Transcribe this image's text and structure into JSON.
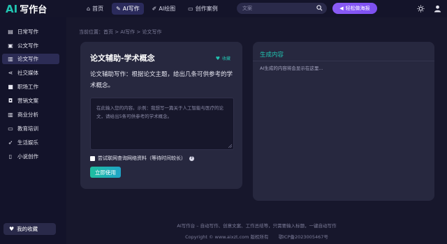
{
  "brand": {
    "logo_ai": "AI",
    "logo_text": "写作台"
  },
  "nav": {
    "items": [
      {
        "label": "首页",
        "icon": "home-icon"
      },
      {
        "label": "AI写作",
        "icon": "edit-icon",
        "active": true
      },
      {
        "label": "AI绘图",
        "icon": "brush-icon"
      },
      {
        "label": "创作案例",
        "icon": "folder-icon"
      }
    ]
  },
  "search": {
    "placeholder": "文案"
  },
  "poster_button": {
    "label": "轻松做海报"
  },
  "sidebar": {
    "items": [
      {
        "label": "日常写作",
        "icon": "book-icon"
      },
      {
        "label": "公文写作",
        "icon": "briefcase-icon"
      },
      {
        "label": "论文写作",
        "icon": "notebook-icon",
        "active": true
      },
      {
        "label": "社交媒体",
        "icon": "share-icon"
      },
      {
        "label": "职场工作",
        "icon": "video-icon"
      },
      {
        "label": "营销文案",
        "icon": "ticket-icon"
      },
      {
        "label": "商业分析",
        "icon": "bar-chart-icon"
      },
      {
        "label": "教育培训",
        "icon": "monitor-icon"
      },
      {
        "label": "生活娱乐",
        "icon": "rocket-icon"
      },
      {
        "label": "小说创作",
        "icon": "book-open-icon"
      }
    ],
    "favorites_label": "我的收藏"
  },
  "breadcrumb": "当前位置：首页 > AI写作 > 论文写作",
  "card": {
    "title": "论文辅助-学术概念",
    "favorite_label": "收藏",
    "description": "论文辅助写作：根据论文主题，给出几条可供参考的学术概念。",
    "input_placeholder": "在此输入您的内容。示例：我想写一篇关于人工智能与医疗的论文，请给出5条可供参考的学术概念。",
    "checkbox_label": "尝试联网查询网络资料（等待时间较长）",
    "submit_label": "立即使用"
  },
  "result": {
    "title": "生成内容",
    "placeholder": "AI生成的内容将会显示在这里..."
  },
  "footer": {
    "line1": "AI写作台 – 自动写作、创意文案、工作总结等，只需要输入标题，一键自动写作",
    "copyright": "Copyright © www.aixzt.com 版权所有",
    "icp": "鄂ICP备2023005467号"
  },
  "colors": {
    "accent": "#21c4b1",
    "purple": "#8b5cf6",
    "background": "#16162a",
    "card": "#27283f"
  }
}
